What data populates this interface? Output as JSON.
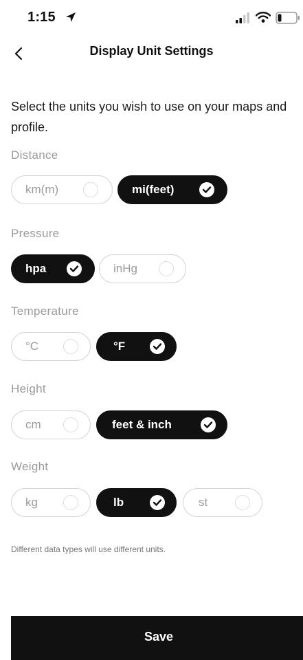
{
  "status": {
    "time": "1:15"
  },
  "header": {
    "title": "Display Unit Settings",
    "back_icon": "chevron-left-icon"
  },
  "description": "Select the units you wish to use on your maps and profile.",
  "sections": [
    {
      "label": "Distance",
      "options": [
        {
          "label": "km(m)",
          "selected": false
        },
        {
          "label": "mi(feet)",
          "selected": true
        }
      ]
    },
    {
      "label": "Pressure",
      "options": [
        {
          "label": "hpa",
          "selected": true
        },
        {
          "label": "inHg",
          "selected": false
        }
      ]
    },
    {
      "label": "Temperature",
      "options": [
        {
          "label": "°C",
          "selected": false
        },
        {
          "label": "°F",
          "selected": true
        }
      ]
    },
    {
      "label": "Height",
      "options": [
        {
          "label": "cm",
          "selected": false
        },
        {
          "label": "feet & inch",
          "selected": true
        }
      ]
    },
    {
      "label": "Weight",
      "options": [
        {
          "label": "kg",
          "selected": false
        },
        {
          "label": "lb",
          "selected": true
        },
        {
          "label": "st",
          "selected": false
        }
      ]
    }
  ],
  "footnote": "Different data types will use different units.",
  "save_label": "Save",
  "colors": {
    "selected_bg": "#111111",
    "unselected_border": "#d3d3d3",
    "muted_text": "#9a9a9a"
  }
}
